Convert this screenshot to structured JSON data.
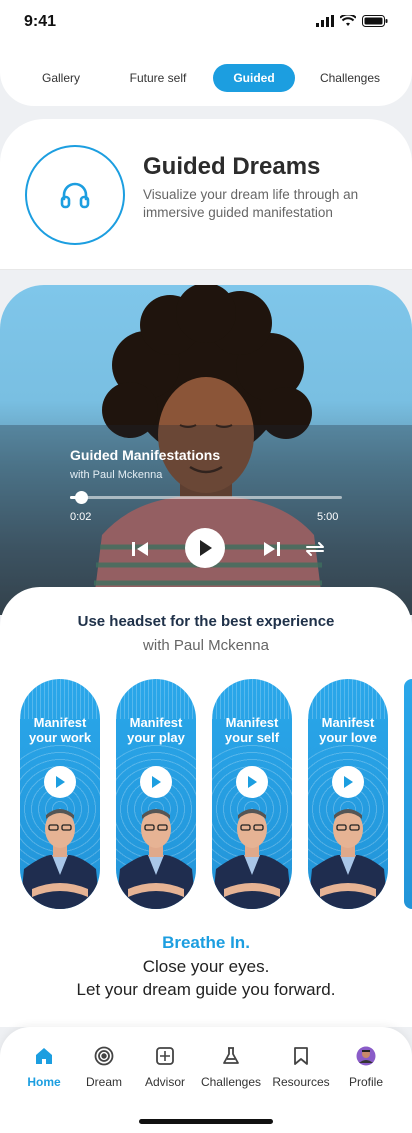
{
  "status": {
    "time": "9:41"
  },
  "tabs": [
    {
      "label": "Gallery",
      "active": false
    },
    {
      "label": "Future self",
      "active": false
    },
    {
      "label": "Guided",
      "active": true
    },
    {
      "label": "Challenges",
      "active": false
    }
  ],
  "header": {
    "title": "Guided Dreams",
    "subtitle": "Visualize your dream life through an immersive guided manifestation",
    "icon": "headphones-icon"
  },
  "player": {
    "title": "Guided Manifestations",
    "subtitle": "with Paul Mckenna",
    "current_time": "0:02",
    "total_time": "5:00",
    "progress": 0.04
  },
  "session": {
    "hint": "Use headset for the best experience",
    "hint_sub": "with Paul Mckenna"
  },
  "tracks": [
    {
      "label": "Manifest your work"
    },
    {
      "label": "Manifest your play"
    },
    {
      "label": "Manifest your self"
    },
    {
      "label": "Manifest your love"
    }
  ],
  "breathe": {
    "title": "Breathe In.",
    "line1": "Close your eyes.",
    "line2": "Let your dream guide you forward."
  },
  "nav": [
    {
      "label": "Home",
      "icon": "home-icon",
      "active": true
    },
    {
      "label": "Dream",
      "icon": "target-icon",
      "active": false
    },
    {
      "label": "Advisor",
      "icon": "sparkle-icon",
      "active": false
    },
    {
      "label": "Challenges",
      "icon": "flask-icon",
      "active": false
    },
    {
      "label": "Resources",
      "icon": "bookmark-icon",
      "active": false
    },
    {
      "label": "Profile",
      "icon": "avatar-icon",
      "active": false
    }
  ],
  "colors": {
    "accent": "#1c9ee0",
    "text": "#222222"
  }
}
